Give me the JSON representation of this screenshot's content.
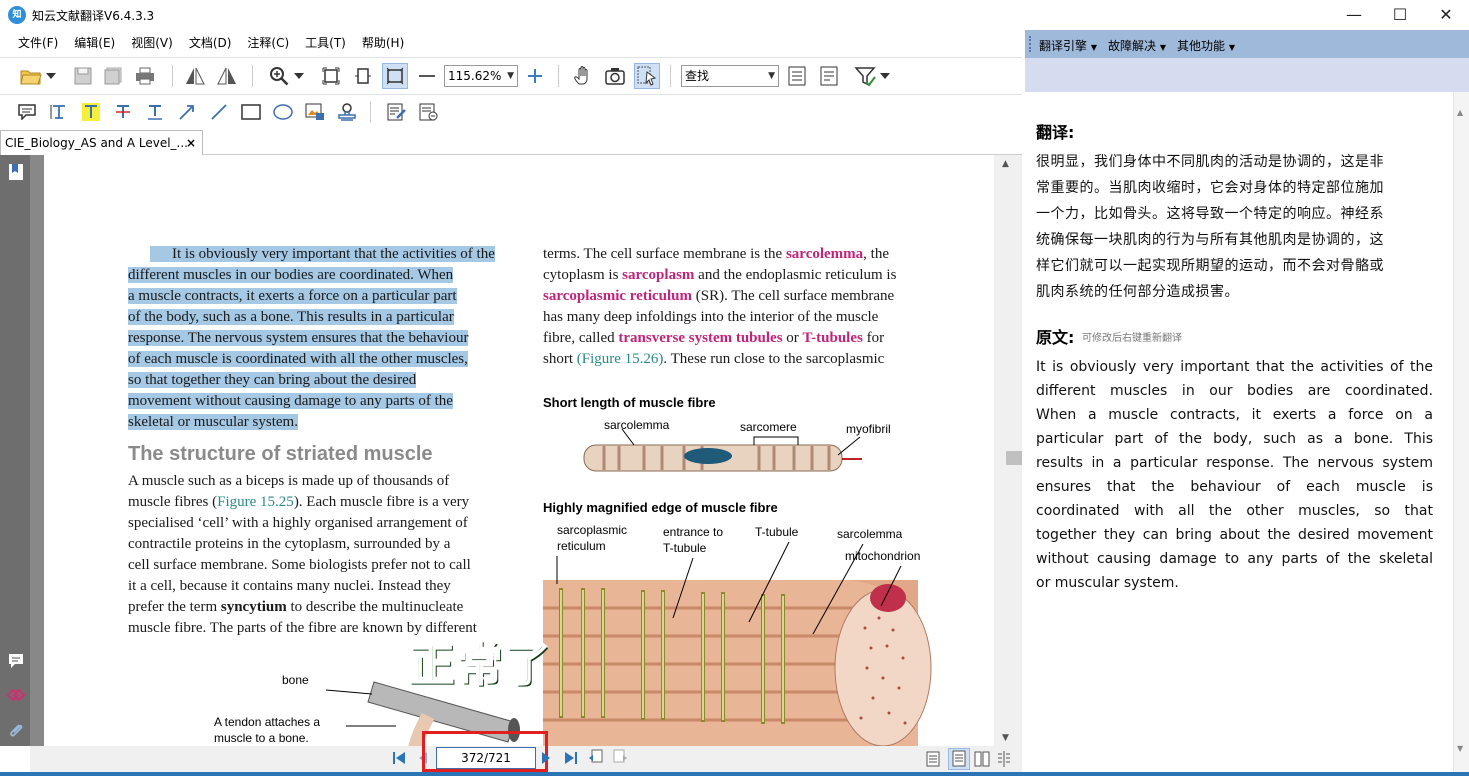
{
  "app": {
    "logo_text": "知",
    "title": "知云文献翻译V6.4.3.3",
    "window_buttons": [
      "—",
      "☐",
      "✕"
    ]
  },
  "menu": [
    "文件(F)",
    "编辑(E)",
    "视图(V)",
    "文档(D)",
    "注释(C)",
    "工具(T)",
    "帮助(H)"
  ],
  "toolbar": {
    "zoom_value": "115.62%",
    "search_placeholder": "查找"
  },
  "tab": {
    "title": "CIE_Biology_AS and A Level_...",
    "close": "×"
  },
  "document": {
    "left_column": [
      "It is obviously very important that the activities of the",
      "different muscles in our bodies are coordinated. When",
      "a muscle contracts, it exerts a force on a particular part",
      "of the body, such as a bone. This results in a particular",
      "response. The nervous system ensures that the behaviour",
      "of each muscle is coordinated with all the other muscles,",
      "so that together they can bring about the desired",
      "movement without causing damage to any parts of the",
      "skeletal or muscular system."
    ],
    "heading": "The structure of striated muscle",
    "body": {
      "l1": "A muscle such as a biceps is made up of thousands of",
      "l2a": "muscle fibres (",
      "l2ref": "Figure 15.25",
      "l2b": "). Each muscle fibre is a very",
      "l3": "specialised ‘cell’ with a highly organised arrangement of",
      "l4": "contractile proteins in the cytoplasm, surrounded by a",
      "l5": "cell surface membrane. Some biologists prefer not to call",
      "l6": "it a cell, because it contains many nuclei. Instead they",
      "l7a": "prefer the term ",
      "l7term": "syncytium",
      "l7b": " to describe the multinucleate",
      "l8": "muscle fibre. The parts of the fibre are known by different"
    },
    "right_column": {
      "r1a": "terms. The cell surface membrane is the ",
      "r1term": "sarcolemma",
      "r1b": ", the",
      "r2a": "cytoplasm is ",
      "r2term": "sarcoplasm",
      "r2b": " and the endoplasmic reticulum is",
      "r3term": "sarcoplasmic reticulum",
      "r3b": " (SR). The cell surface membrane",
      "r4": "has many deep infoldings into the interior of the muscle",
      "r5a": "fibre, called ",
      "r5term": "transverse system tubules",
      "r5b": " or ",
      "r5term2": "T-tubules",
      "r5c": " for",
      "r6a": "short ",
      "r6ref": "(Figure 15.26)",
      "r6b": ". These run close to the sarcoplasmic"
    },
    "figure1": {
      "title": "Short length of muscle fibre",
      "labels": [
        "sarcolemma",
        "sarcomere",
        "myofibril"
      ]
    },
    "figure2": {
      "title": "Highly magnified edge of muscle fibre",
      "labels": [
        "sarcoplasmic",
        "reticulum",
        "entrance to",
        "T-tubule",
        "T-tubule",
        "sarcolemma",
        "mitochondrion"
      ]
    },
    "figure3": {
      "labels": [
        "bone",
        "A tendon attaches a",
        "muscle to a bone."
      ]
    },
    "overlay_text": "正常了"
  },
  "status": {
    "page_indicator": "372/721"
  },
  "right_panel": {
    "header_items": [
      "翻译引擎",
      "故障解决",
      "其他功能"
    ],
    "translation_title": "翻译:",
    "translation_lines": [
      "很明显，我们身体中不同肌肉的活动是协调的，这是非",
      "常重要的。当肌肉收缩时，它会对身体的特定部位施加",
      "一个力，比如骨头。这将导致一个特定的响应。神经系",
      "统确保每一块肌肉的行为与所有其他肌肉是协调的，这",
      "样它们就可以一起实现所期望的运动，而不会对骨骼或",
      "肌肉系统的任何部分造成损害。"
    ],
    "original_title": "原文:",
    "original_hint": "可修改后右键重新翻译",
    "original_lines": [
      "It is obviously very important that the activities of the",
      "different muscles in our bodies are coordinated.",
      "When a muscle contracts, it exerts a force on a",
      "particular part of the body, such as a bone. This",
      "results in a particular response. The nervous system",
      "ensures that the behaviour of each muscle is",
      "coordinated with all the other muscles, so that",
      "together they can bring about the desired movement",
      "without causing damage to any parts of the skeletal",
      "or muscular system."
    ]
  },
  "colors": {
    "highlight": "#a5c8e4",
    "term_pink": "#c0257a",
    "figure_ref": "#2b8a8a",
    "right_header": "#9fb9da",
    "annotation_box": "#e02020",
    "overlay_green": "#1f7a2a"
  }
}
